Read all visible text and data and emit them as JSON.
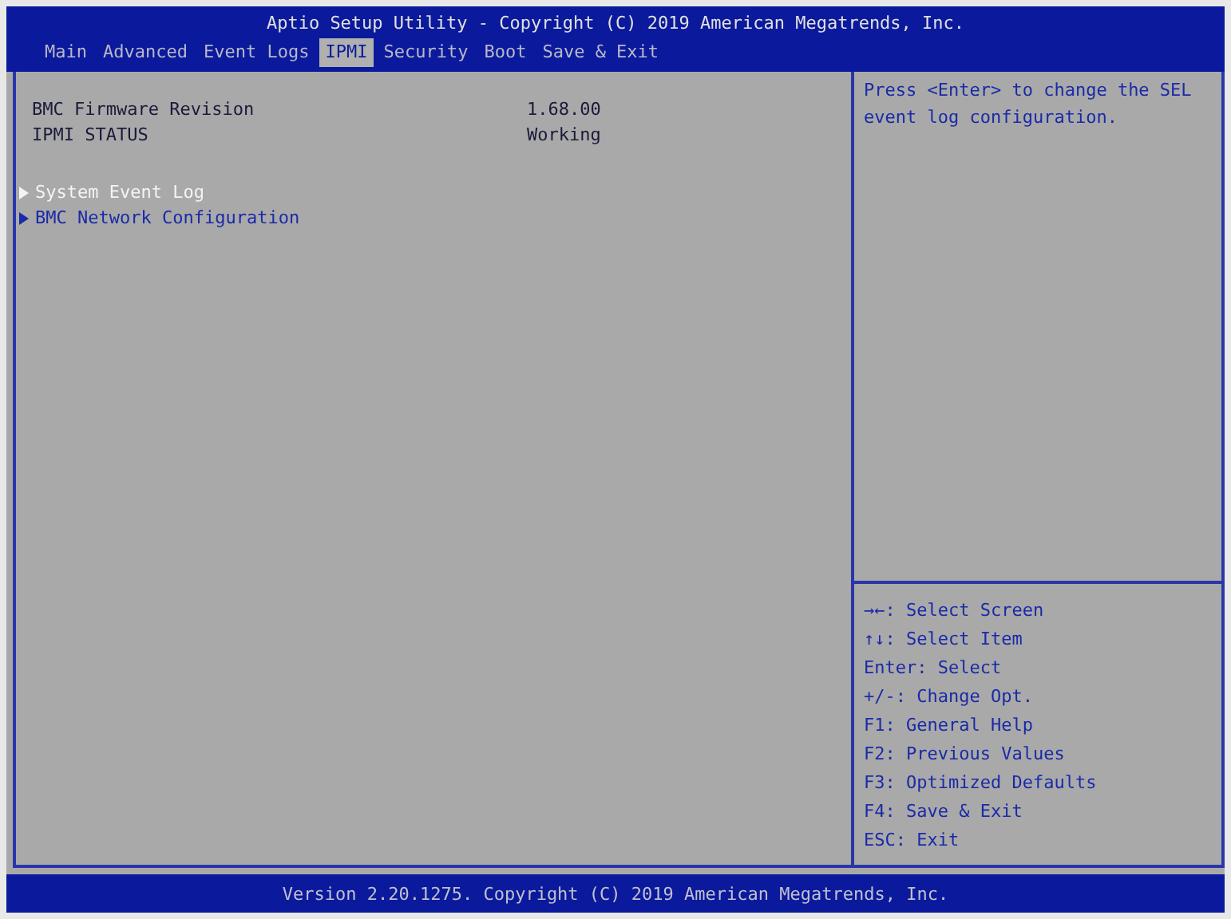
{
  "header": {
    "title": "Aptio Setup Utility - Copyright (C) 2019 American Megatrends, Inc."
  },
  "tabs": [
    {
      "label": "Main",
      "selected": false
    },
    {
      "label": "Advanced",
      "selected": false
    },
    {
      "label": "Event Logs",
      "selected": false
    },
    {
      "label": "IPMI",
      "selected": true
    },
    {
      "label": "Security",
      "selected": false
    },
    {
      "label": "Boot",
      "selected": false
    },
    {
      "label": "Save & Exit",
      "selected": false
    }
  ],
  "info_rows": [
    {
      "label": "BMC Firmware Revision",
      "value": "1.68.00"
    },
    {
      "label": "IPMI STATUS",
      "value": "Working"
    }
  ],
  "submenus": [
    {
      "label": "System Event Log",
      "selected": true
    },
    {
      "label": "BMC Network Configuration",
      "selected": false
    }
  ],
  "help_text": "Press <Enter> to change the SEL event log configuration.",
  "key_help": [
    "→←: Select Screen",
    "↑↓: Select Item",
    "Enter: Select",
    "+/-: Change Opt.",
    "F1: General Help",
    "F2: Previous Values",
    "F3: Optimized Defaults",
    "F4: Save & Exit",
    "ESC: Exit"
  ],
  "footer": {
    "text": "Version 2.20.1275. Copyright (C) 2019 American Megatrends, Inc."
  }
}
